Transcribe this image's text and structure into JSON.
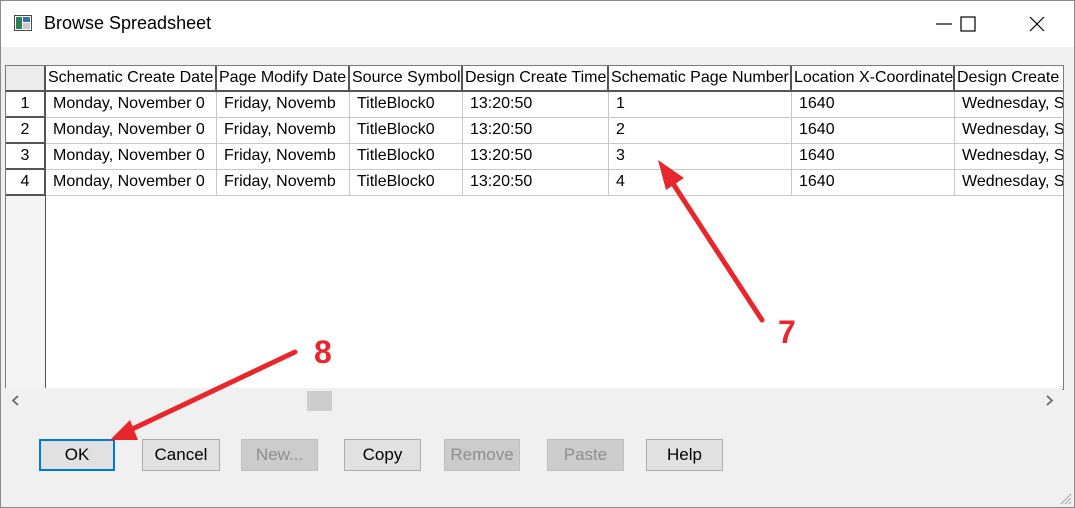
{
  "window": {
    "title": "Browse Spreadsheet",
    "colors": {
      "accent": "#0078d7",
      "annotation": "#e8262d"
    }
  },
  "grid": {
    "columns": [
      "Schematic Create Date",
      "Page Modify Date",
      "Source Symbol",
      "Design Create Time",
      "Schematic Page Number",
      "Location X-Coordinate",
      "Design Create"
    ],
    "rows": [
      {
        "num": "1",
        "cells": [
          "Monday, November 0",
          "Friday, Novemb",
          "TitleBlock0",
          "13:20:50",
          "1",
          "1640",
          "Wednesday, S"
        ]
      },
      {
        "num": "2",
        "cells": [
          "Monday, November 0",
          "Friday, Novemb",
          "TitleBlock0",
          "13:20:50",
          "2",
          "1640",
          "Wednesday, S"
        ]
      },
      {
        "num": "3",
        "cells": [
          "Monday, November 0",
          "Friday, Novemb",
          "TitleBlock0",
          "13:20:50",
          "3",
          "1640",
          "Wednesday, S"
        ]
      },
      {
        "num": "4",
        "cells": [
          "Monday, November 0",
          "Friday, Novemb",
          "TitleBlock0",
          "13:20:50",
          "4",
          "1640",
          "Wednesday, S"
        ]
      }
    ]
  },
  "buttons": {
    "ok": "OK",
    "cancel": "Cancel",
    "new": "New...",
    "copy": "Copy",
    "remove": "Remove",
    "paste": "Paste",
    "help": "Help"
  },
  "annotations": {
    "step7": "7",
    "step8": "8"
  }
}
